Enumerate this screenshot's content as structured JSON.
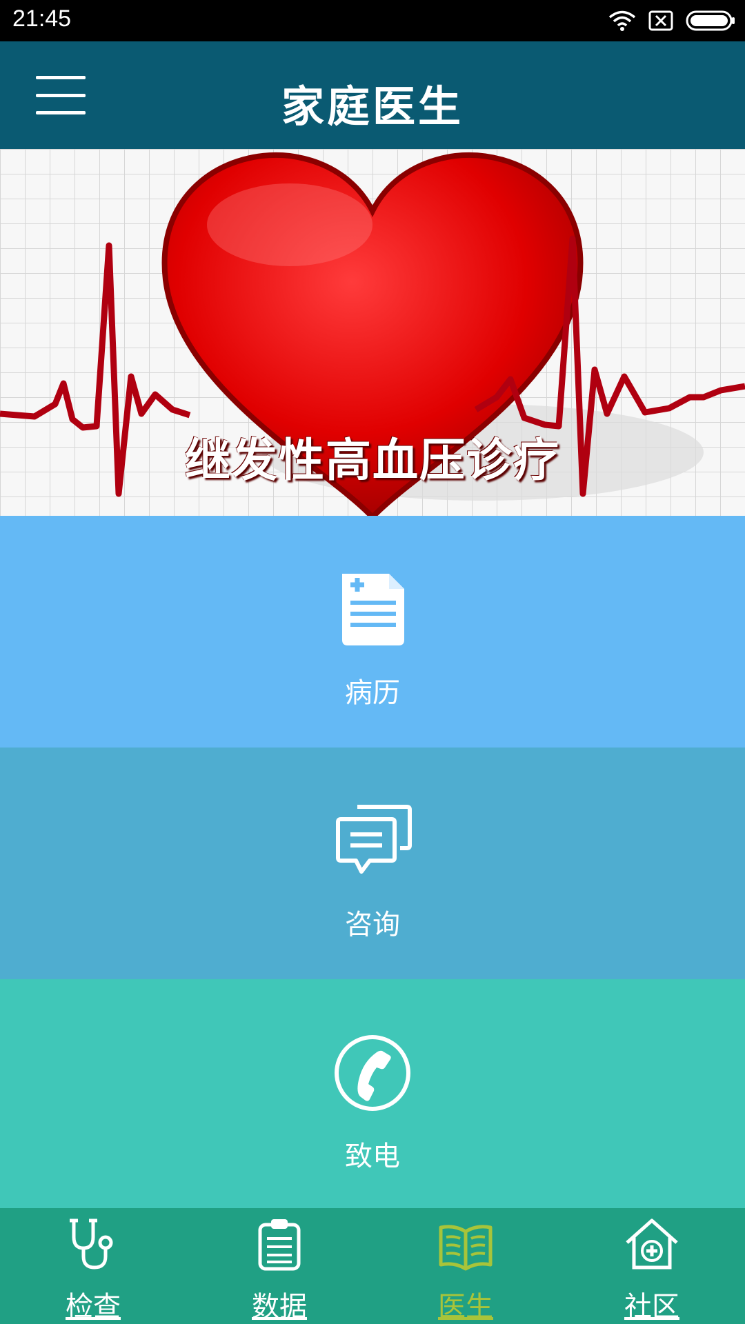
{
  "status_bar": {
    "time": "21:45"
  },
  "app_bar": {
    "title": "家庭医生",
    "menu_icon": "hamburger-menu-icon"
  },
  "banner": {
    "caption": "继发性高血压诊疗",
    "slides": 3,
    "active_slide": 3
  },
  "tiles": [
    {
      "label": "病历",
      "icon": "medical-record-icon",
      "color": "#64b9f5"
    },
    {
      "label": "咨询",
      "icon": "chat-bubbles-icon",
      "color": "#4fadd0"
    },
    {
      "label": "致电",
      "icon": "phone-icon",
      "color": "#40c7b8"
    }
  ],
  "tab_bar": {
    "background": "#20a084",
    "active_color": "#a8c43a",
    "items": [
      {
        "label": "检查",
        "icon": "stethoscope-icon",
        "active": false
      },
      {
        "label": "数据",
        "icon": "clipboard-icon",
        "active": false
      },
      {
        "label": "医生",
        "icon": "open-book-icon",
        "active": true
      },
      {
        "label": "社区",
        "icon": "hospital-home-icon",
        "active": false
      }
    ]
  }
}
